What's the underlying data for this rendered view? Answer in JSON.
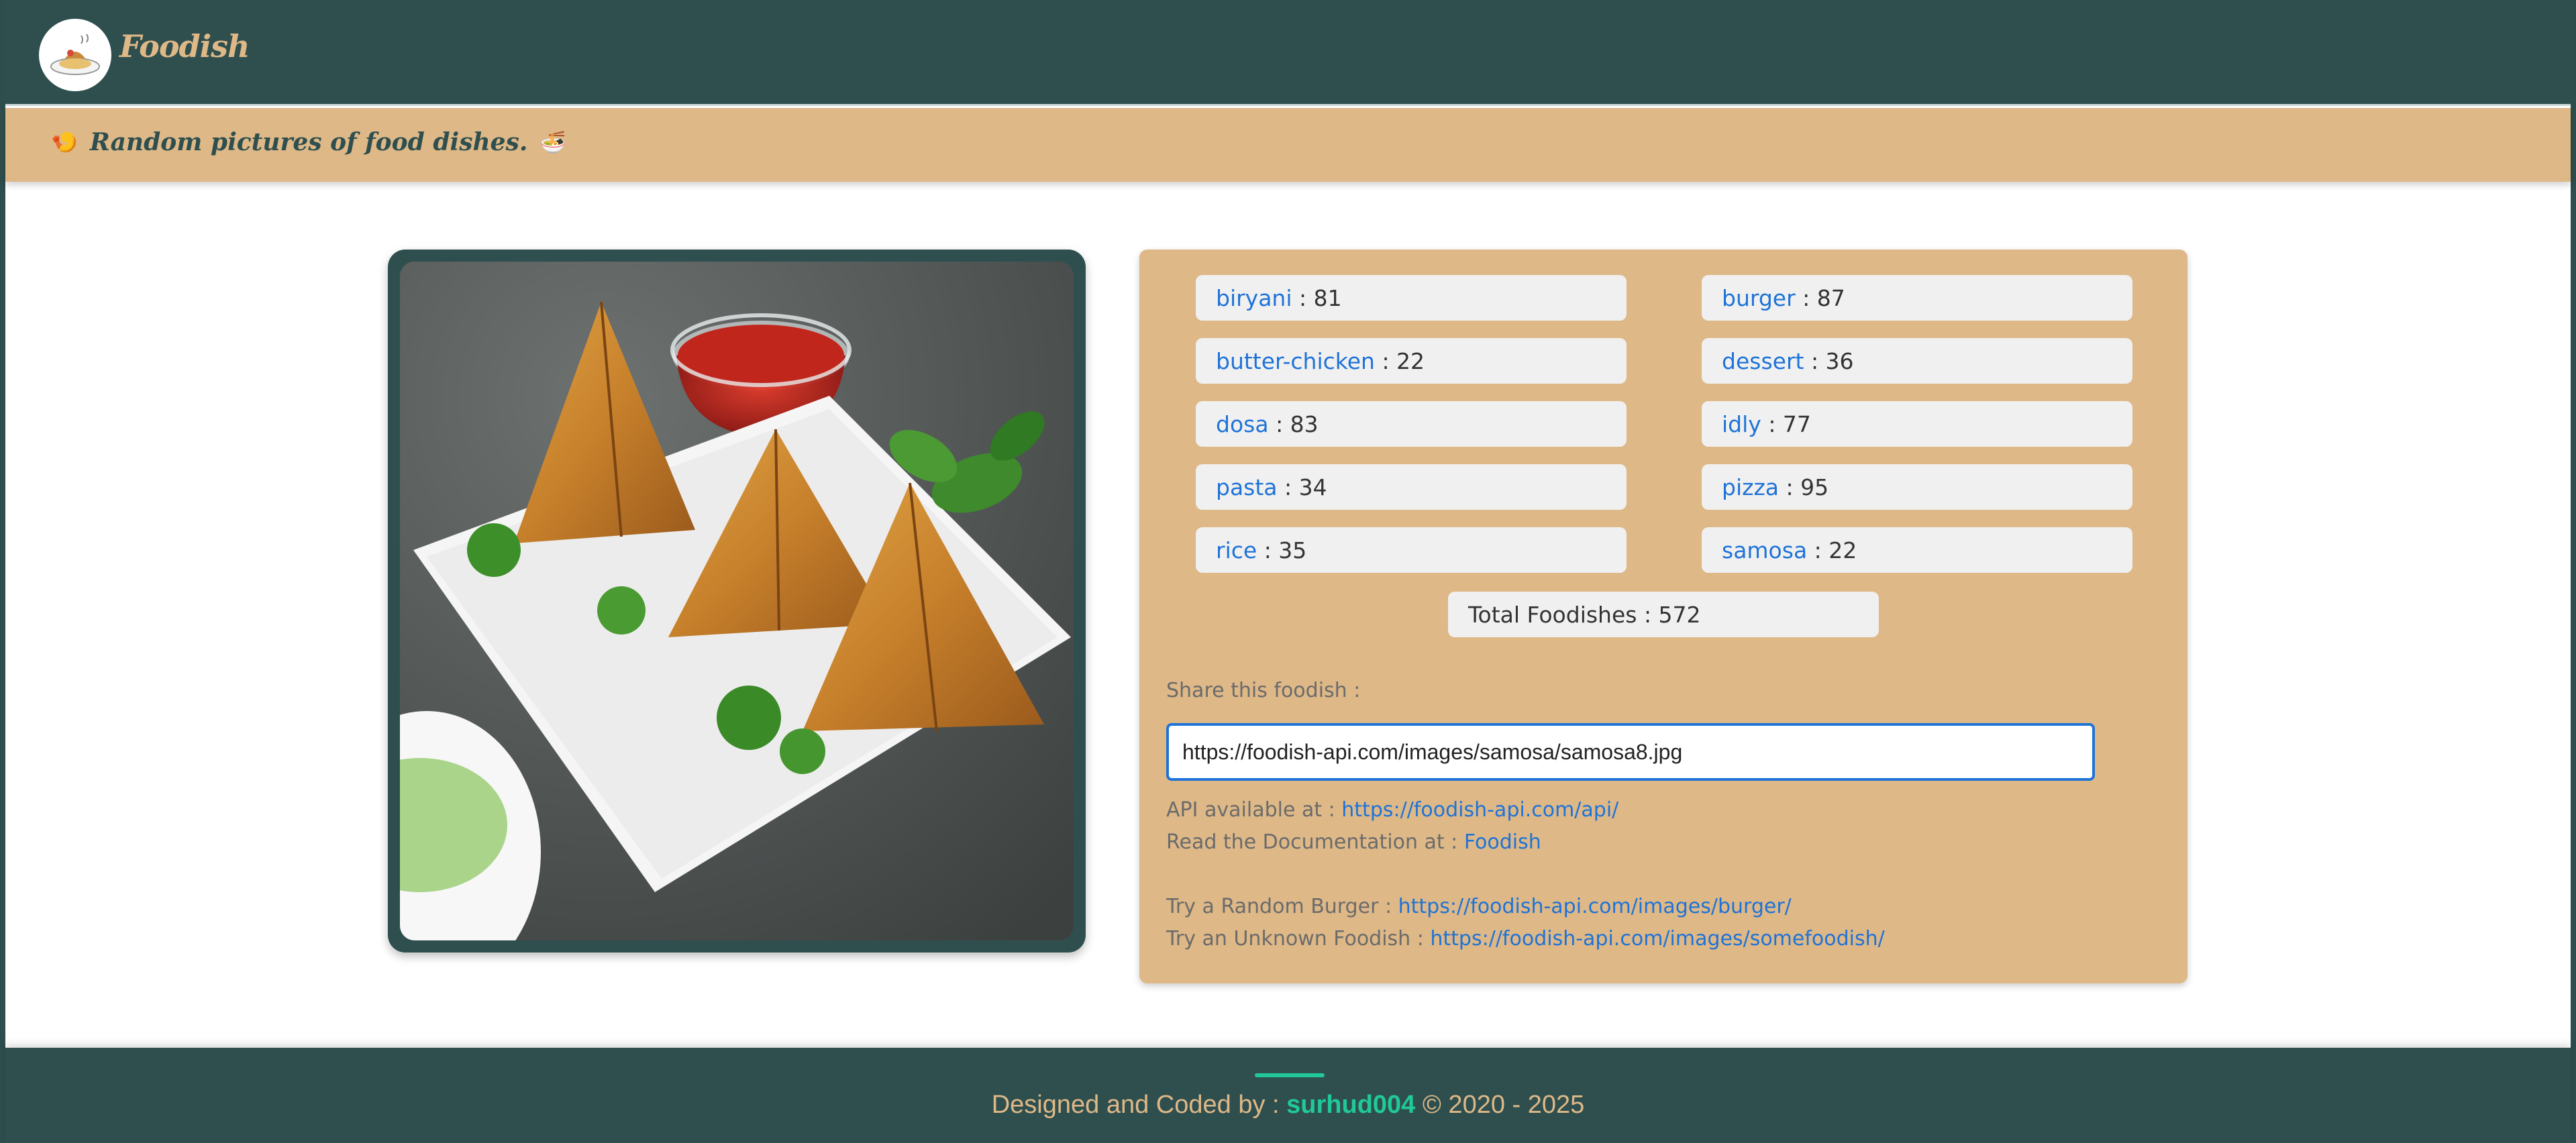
{
  "navbar": {
    "brand": "Foodish",
    "logo_icon": "food-plate-logo"
  },
  "banner": {
    "left_emoji": "🍤",
    "text": "Random pictures of food dishes.",
    "right_emoji": "🍜"
  },
  "image": {
    "subject": "samosa"
  },
  "stats": {
    "categories": [
      {
        "name": "biryani",
        "count": ": 81"
      },
      {
        "name": "burger",
        "count": ": 87"
      },
      {
        "name": "butter-chicken",
        "count": ": 22"
      },
      {
        "name": "dessert",
        "count": ": 36"
      },
      {
        "name": "dosa",
        "count": ": 83"
      },
      {
        "name": "idly",
        "count": ": 77"
      },
      {
        "name": "pasta",
        "count": ": 34"
      },
      {
        "name": "pizza",
        "count": ": 95"
      },
      {
        "name": "rice",
        "count": ": 35"
      },
      {
        "name": "samosa",
        "count": ": 22"
      }
    ],
    "total": "Total Foodishes : 572"
  },
  "share": {
    "label": "Share this foodish :",
    "value": "https://foodish-api.com/images/samosa/samosa8.jpg"
  },
  "info": {
    "api_label": "API available at :",
    "api_link": "https://foodish-api.com/api/",
    "docs_label": "Read the Documentation at :",
    "docs_link": "Foodish",
    "burger_label": "Try a Random Burger :",
    "burger_link": "https://foodish-api.com/images/burger/",
    "unknown_label": "Try an Unknown Foodish :",
    "unknown_link": "https://foodish-api.com/images/somefoodish/"
  },
  "footer": {
    "prefix": "Designed and Coded by :",
    "author": "surhud004",
    "suffix": "© 2020 - 2025"
  },
  "colors": {
    "primary": "#2f4f4f",
    "accent": "#deb887",
    "link": "#1e73d8",
    "footer_author": "#20c997"
  }
}
